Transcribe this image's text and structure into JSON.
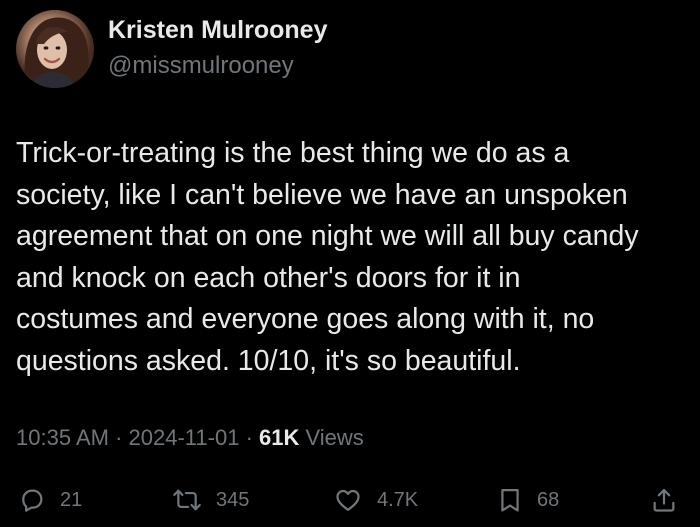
{
  "author": {
    "display_name": "Kristen Mulrooney",
    "handle": "@missmulrooney"
  },
  "tweet": {
    "lines": [
      "Trick-or-treating is the best thing we do as a",
      "society, like I can't believe we have an unspoken",
      "agreement that on one night we will all buy candy",
      "and knock on each other's doors for it in",
      "costumes and everyone goes along with it, no",
      "questions asked. 10/10, it's so beautiful."
    ]
  },
  "meta": {
    "time": "10:35 AM",
    "date": "2024-11-01",
    "views_count": "61K",
    "views_label": "Views"
  },
  "actions": {
    "replies": "21",
    "reposts": "345",
    "likes": "4.7K",
    "bookmarks": "68"
  },
  "colors": {
    "background": "#000000",
    "primary_text": "#e7e9ea",
    "secondary_text": "#71767b"
  },
  "icons": [
    "reply-icon",
    "repost-icon",
    "like-icon",
    "bookmark-icon",
    "share-icon"
  ]
}
